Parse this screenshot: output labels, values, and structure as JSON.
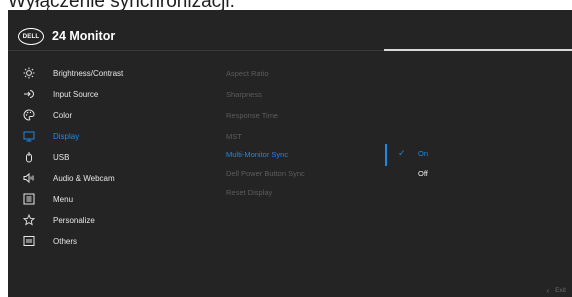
{
  "caption": "Wyłączenie synchronizacji.",
  "header": {
    "logo_text": "DELL",
    "title": "24 Monitor"
  },
  "menu": [
    {
      "label": "Brightness/Contrast",
      "icon": "brightness-icon"
    },
    {
      "label": "Input Source",
      "icon": "input-source-icon"
    },
    {
      "label": "Color",
      "icon": "color-palette-icon"
    },
    {
      "label": "Display",
      "icon": "display-icon",
      "active": true
    },
    {
      "label": "USB",
      "icon": "usb-icon"
    },
    {
      "label": "Audio & Webcam",
      "icon": "speaker-icon"
    },
    {
      "label": "Menu",
      "icon": "menu-icon"
    },
    {
      "label": "Personalize",
      "icon": "star-icon"
    },
    {
      "label": "Others",
      "icon": "others-icon"
    }
  ],
  "submenu": [
    {
      "label": "Aspect Ratio"
    },
    {
      "label": "Sharpness"
    },
    {
      "label": "Response Time"
    },
    {
      "label": "MST"
    },
    {
      "label": "Multi-Monitor Sync",
      "active": true
    },
    {
      "label": "Dell Power Button Sync"
    },
    {
      "label": "Reset Display"
    }
  ],
  "options": [
    {
      "label": "On",
      "selected": true
    },
    {
      "label": "Off",
      "selected": false
    }
  ],
  "footer": {
    "exit_label": "Exit"
  },
  "colors": {
    "background": "#242424",
    "accent": "#1e88e5",
    "disabled_text": "#5c5c5c"
  }
}
